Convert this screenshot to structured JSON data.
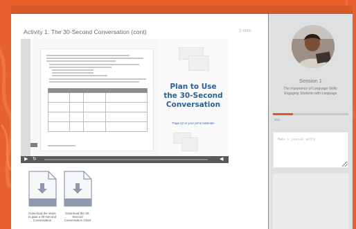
{
  "lesson": {
    "activity_title": "Activity 1: The 30-Second Conversation (cont)",
    "duration": "2 mins"
  },
  "video": {
    "slide_title_lines": [
      "Plan to Use",
      "the 30-Second",
      "Conversation"
    ],
    "slide_subtitle": "Page 12 in your print materials"
  },
  "downloads": [
    {
      "label": "Download the steps to plan a 30-Second Conversation",
      "icon": "download-document-icon"
    },
    {
      "label": "Download the 30-Second Conversation Chart",
      "icon": "download-document-icon"
    }
  ],
  "sidebar": {
    "session_title": "Session 1",
    "session_description": "The Importance of Language Skills: Engaging Students with Language",
    "progress_text": "3/11",
    "progress_fraction": 0.27,
    "journal_placeholder": "Make a journal entry"
  },
  "colors": {
    "accent": "#e2542a",
    "background": "#e8602e",
    "slide_title": "#2a5f97",
    "sidebar": "#dfe0e1"
  }
}
